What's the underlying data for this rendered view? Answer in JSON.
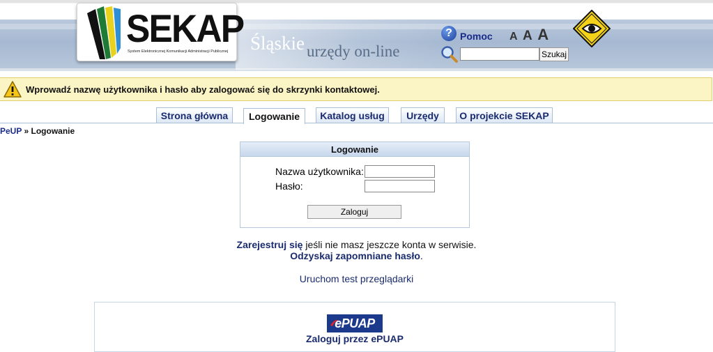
{
  "header": {
    "logo_text": "SEKAP",
    "logo_subtitle": "System Elektronicznej Komunikacji Administracji Publicznej",
    "slogan_part1": "Śląskie",
    "slogan_part2": "urzędy on-line",
    "help_label": "Pomoc",
    "font_size_labels": [
      "A",
      "A",
      "A"
    ],
    "search": {
      "value": "",
      "button_label": "Szukaj"
    },
    "icons": {
      "help": "question-icon",
      "search": "magnifier-icon",
      "accessibility": "eye-icon"
    }
  },
  "warning": {
    "text": "Wprowadź nazwę użytkownika i hasło aby zalogować się do skrzynki kontaktowej.",
    "icon": "warning-icon"
  },
  "tabs": [
    {
      "label": "Strona główna",
      "active": false
    },
    {
      "label": "Logowanie",
      "active": true
    },
    {
      "label": "Katalog usług",
      "active": false
    },
    {
      "label": "Urzędy",
      "active": false
    },
    {
      "label": "O projekcie SEKAP",
      "active": false
    }
  ],
  "breadcrumb": {
    "root": "PeUP",
    "separator": "»",
    "current": "Logowanie"
  },
  "login": {
    "title": "Logowanie",
    "username_label": "Nazwa użytkownika:",
    "username_value": "",
    "password_label": "Hasło:",
    "password_value": "",
    "submit_label": "Zaloguj"
  },
  "links": {
    "register_link": "Zarejestruj się",
    "register_rest": " jeśli nie masz jeszcze konta w serwisie.",
    "recover_link": "Odzyskaj zapomniane hasło",
    "recover_rest": ".",
    "browser_test": "Uruchom test przeglądarki"
  },
  "epuap": {
    "logo_text": "ePUAP",
    "login_label": "Zaloguj przez ePUAP"
  },
  "colors": {
    "header_band": "#a6b9d2",
    "link": "#1a2b6e",
    "warning_bg": "#fbf4c4",
    "tab_border": "#a9bfd7"
  }
}
